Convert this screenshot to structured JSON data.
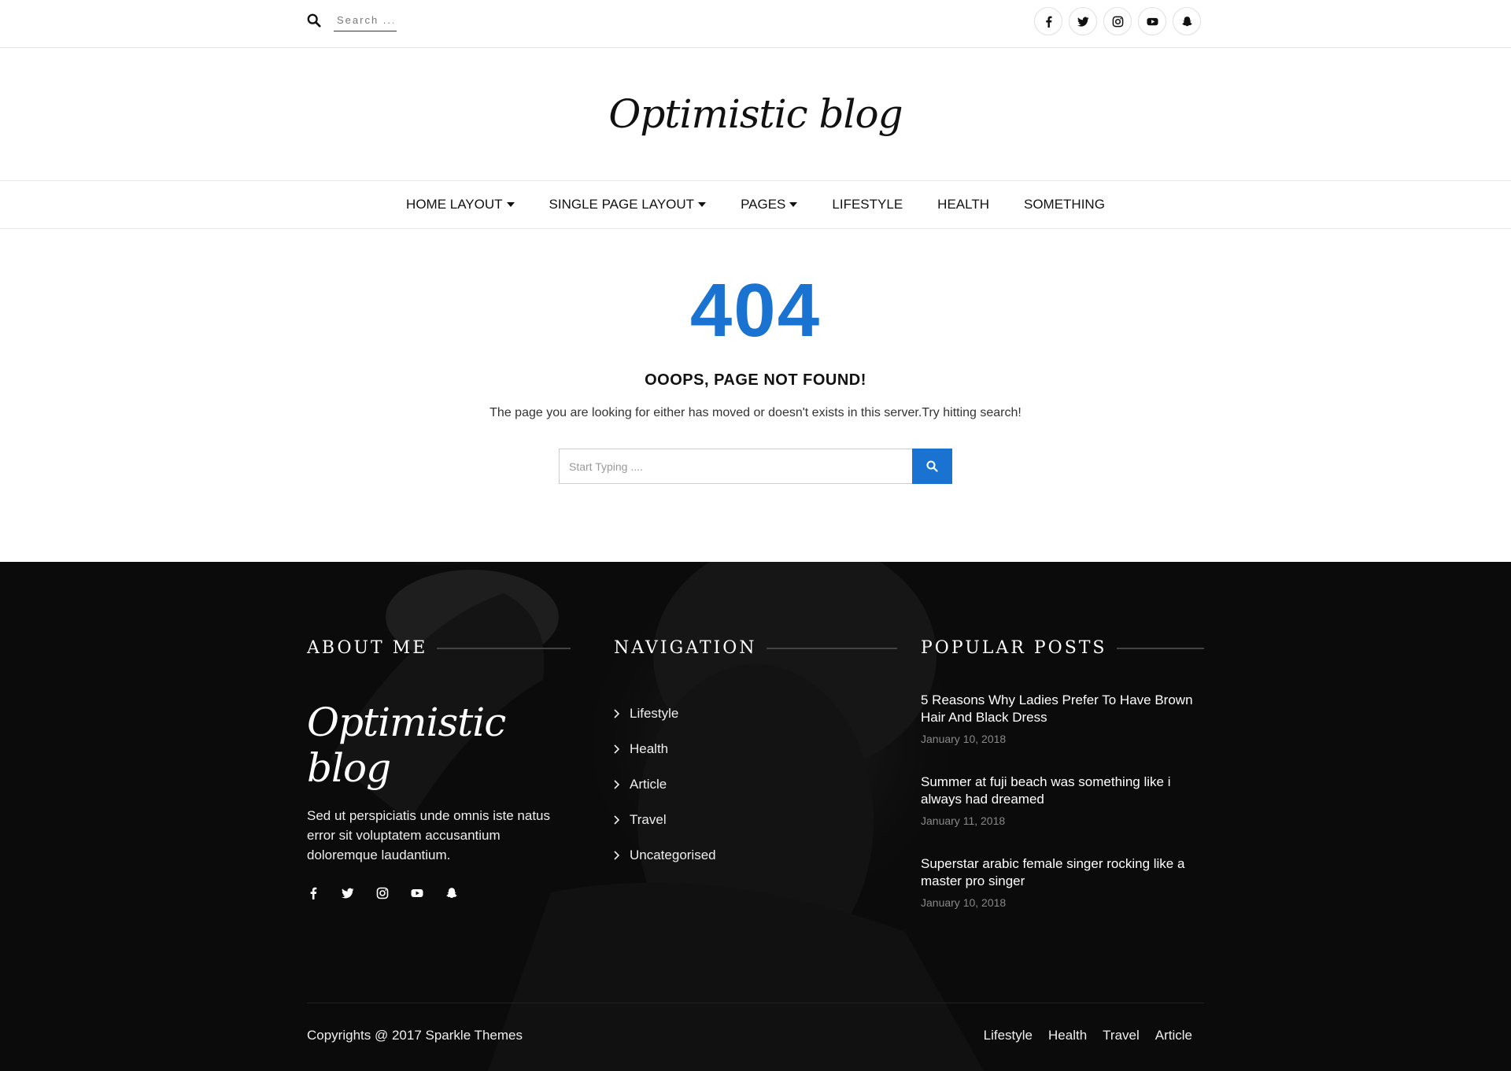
{
  "topbar": {
    "search_placeholder": "Search ...",
    "social_icons": [
      "facebook-icon",
      "twitter-icon",
      "instagram-icon",
      "youtube-icon",
      "snapchat-icon"
    ]
  },
  "logo": {
    "text": "Optimistic blog"
  },
  "nav": {
    "items": [
      {
        "label": "HOME LAYOUT",
        "has_dropdown": true
      },
      {
        "label": "SINGLE PAGE LAYOUT",
        "has_dropdown": true
      },
      {
        "label": "PAGES",
        "has_dropdown": true
      },
      {
        "label": "LIFESTYLE",
        "has_dropdown": false
      },
      {
        "label": "HEALTH",
        "has_dropdown": false
      },
      {
        "label": "SOMETHING",
        "has_dropdown": false
      }
    ]
  },
  "error": {
    "code": "404",
    "title": "OOOPS, PAGE NOT FOUND!",
    "description": "The page you are looking for either has moved or doesn't exists in this server.Try hitting search!",
    "search_placeholder": "Start Typing ....",
    "accent_color": "#1a73d1"
  },
  "footer": {
    "about": {
      "heading": "ABOUT ME",
      "logo_text": "Optimistic blog",
      "text": "Sed ut perspiciatis unde omnis iste natus error sit voluptatem accusantium doloremque laudantium."
    },
    "navigation": {
      "heading": "NAVIGATION",
      "items": [
        "Lifestyle",
        "Health",
        "Article",
        "Travel",
        "Uncategorised"
      ]
    },
    "popular": {
      "heading": "POPULAR POSTS",
      "posts": [
        {
          "title": "5 Reasons Why Ladies Prefer To Have Brown Hair And Black Dress",
          "date": "January 10, 2018"
        },
        {
          "title": "Summer at fuji beach was something like i always had dreamed",
          "date": "January 11, 2018"
        },
        {
          "title": "Superstar arabic female singer rocking like a master pro singer",
          "date": "January 10, 2018"
        }
      ]
    },
    "copyright": "Copyrights @ 2017 Sparkle Themes",
    "bottom_links": [
      "Lifestyle",
      "Health",
      "Travel",
      "Article"
    ]
  }
}
